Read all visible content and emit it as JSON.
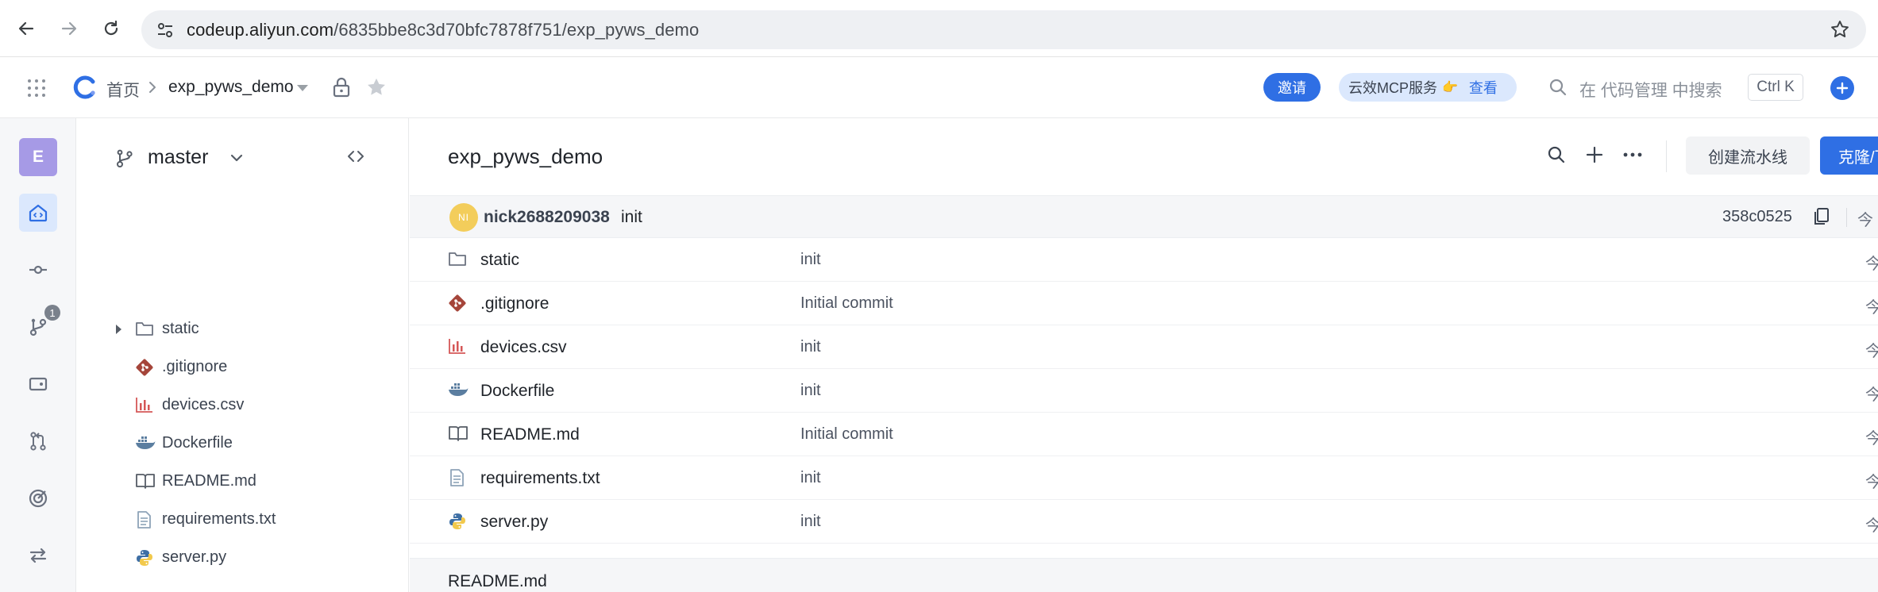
{
  "browser": {
    "url_host": "codeup.aliyun.com",
    "url_path": "/6835bbe8c3d70bfc7878f751/exp_pyws_demo"
  },
  "header": {
    "breadcrumb_home": "首页",
    "repo_name": "exp_pyws_demo",
    "invite_label": "邀请",
    "mcp_label": "云效MCP服务",
    "mcp_view_label": "查看",
    "search_placeholder": "在 代码管理 中搜索",
    "search_shortcut": "Ctrl K",
    "accent_color": "#2f6fe4"
  },
  "rail": {
    "avatar_letter": "E",
    "branches_badge": "1",
    "items": [
      "home-icon",
      "commit-icon",
      "branch-icon",
      "tag-icon",
      "merge-request-icon",
      "target-icon",
      "sync-icon"
    ]
  },
  "tree": {
    "branch": "master",
    "items": [
      {
        "name": "static",
        "icon": "folder-icon"
      },
      {
        "name": ".gitignore",
        "icon": "git-icon"
      },
      {
        "name": "devices.csv",
        "icon": "csv-chart-icon"
      },
      {
        "name": "Dockerfile",
        "icon": "docker-icon"
      },
      {
        "name": "README.md",
        "icon": "book-icon"
      },
      {
        "name": "requirements.txt",
        "icon": "text-file-icon"
      },
      {
        "name": "server.py",
        "icon": "python-icon"
      }
    ]
  },
  "main": {
    "title": "exp_pyws_demo",
    "pipeline_button": "创建流水线",
    "clone_button": "克隆/下载",
    "commit": {
      "avatar_initials": "NI",
      "author": "nick2688209038",
      "message": "init",
      "sha": "358c0525",
      "time": "今"
    },
    "files": [
      {
        "name": "static",
        "message": "init",
        "time": "今"
      },
      {
        "name": ".gitignore",
        "message": "Initial commit",
        "time": "今"
      },
      {
        "name": "devices.csv",
        "message": "init",
        "time": "今"
      },
      {
        "name": "Dockerfile",
        "message": "init",
        "time": "今"
      },
      {
        "name": "README.md",
        "message": "Initial commit",
        "time": "今"
      },
      {
        "name": "requirements.txt",
        "message": "init",
        "time": "今"
      },
      {
        "name": "server.py",
        "message": "init",
        "time": "今"
      }
    ],
    "readme_title": "README.md"
  }
}
